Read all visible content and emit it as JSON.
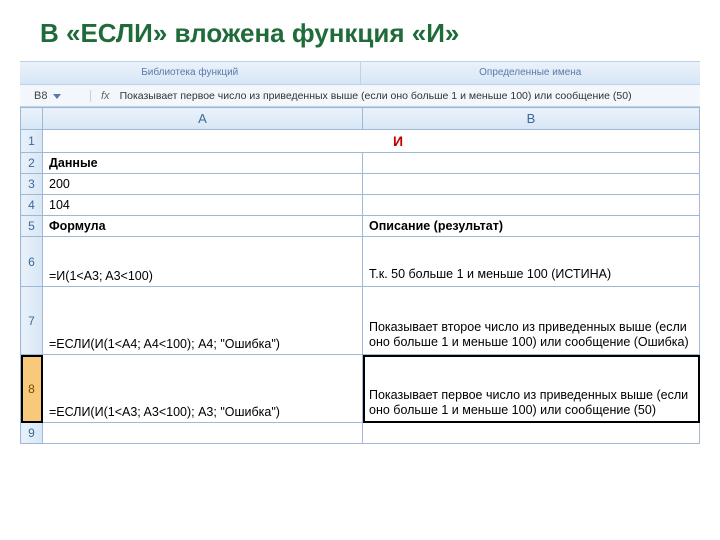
{
  "title": "В «ЕСЛИ» вложена функция «И»",
  "ribbon": {
    "group1": "Библиотека функций",
    "group2": "Определенные имена"
  },
  "nameBox": "B8",
  "fxLabel": "fx",
  "formulaBar": "Показывает первое число из приведенных выше (если оно больше 1 и меньше 100) или сообщение (50)",
  "cols": {
    "a": "A",
    "b": "B"
  },
  "rows": {
    "1": {
      "b": "И"
    },
    "2": {
      "a": "Данные"
    },
    "3": {
      "a": "200"
    },
    "4": {
      "a": "104"
    },
    "5": {
      "a": "Формула",
      "b": "Описание (результат)"
    },
    "6": {
      "a": "=И(1<A3; A3<100)",
      "b": "Т.к. 50 больше 1 и меньше 100 (ИСТИНА)"
    },
    "7": {
      "a": "=ЕСЛИ(И(1<A4; A4<100); A4; \"Ошибка\")",
      "b": "Показывает второе число из приведенных выше (если оно больше 1 и меньше 100) или сообщение (Ошибка)"
    },
    "8": {
      "a": "=ЕСЛИ(И(1<A3; A3<100); A3; \"Ошибка\")",
      "b": "Показывает первое число из приведенных выше (если оно больше 1 и меньше 100) или сообщение (50)"
    }
  },
  "rowNums": {
    "r1": "1",
    "r2": "2",
    "r3": "3",
    "r4": "4",
    "r5": "5",
    "r6": "6",
    "r7": "7",
    "r8": "8",
    "r9": "9"
  }
}
